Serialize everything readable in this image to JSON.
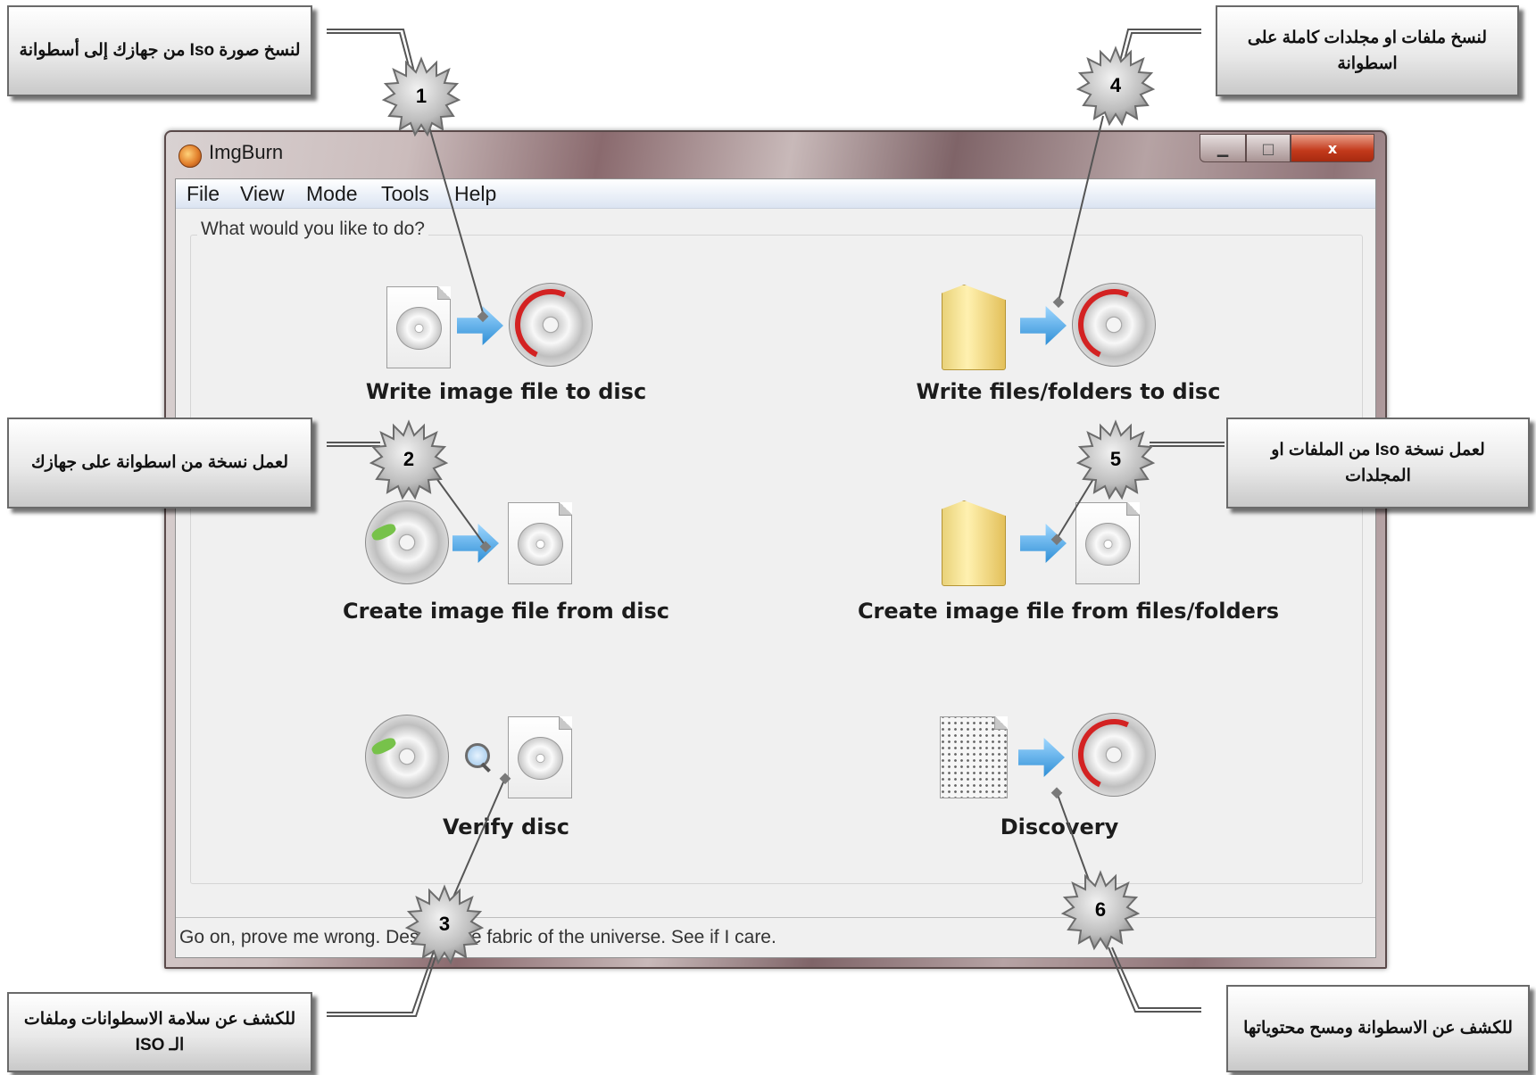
{
  "window": {
    "title": "ImgBurn",
    "menu": [
      "File",
      "View",
      "Mode",
      "Tools",
      "Help"
    ],
    "controls": {
      "minimize": "▁",
      "maximize": "□",
      "close": "x"
    },
    "group_label": "What would you like to do?",
    "actions": [
      {
        "label": "Write image file to disc"
      },
      {
        "label": "Write files/folders to disc"
      },
      {
        "label": "Create image file from disc"
      },
      {
        "label": "Create image file from files/folders"
      },
      {
        "label": "Verify disc"
      },
      {
        "label": "Discovery"
      }
    ],
    "status": "Go on, prove me wrong. Destroy the fabric of the universe. See if I care."
  },
  "annotations": [
    {
      "number": "1",
      "text": "لنسخ صورة Iso من جهازك إلى أسطوانة"
    },
    {
      "number": "2",
      "text": "لعمل نسخة من اسطوانة على جهازك"
    },
    {
      "number": "3",
      "text": "للكشف عن سلامة الاسطوانات وملفات الـ ISO"
    },
    {
      "number": "4",
      "text": "لنسخ ملفات او مجلدات كاملة على اسطوانة"
    },
    {
      "number": "5",
      "text": "لعمل نسخة Iso من الملفات او المجلدات"
    },
    {
      "number": "6",
      "text": "للكشف عن الاسطوانة ومسح محتوياتها"
    }
  ],
  "colors": {
    "badge_fill": "#c8c8c8",
    "leader_line": "#555555",
    "disc_red": "#d32222",
    "arrow_blue": "#2f8fd6"
  },
  "icons": [
    "imgburn-app-icon",
    "image-file-icon",
    "disc-icon",
    "folder-icon",
    "arrow-icon",
    "magnifier-icon",
    "data-page-icon"
  ]
}
